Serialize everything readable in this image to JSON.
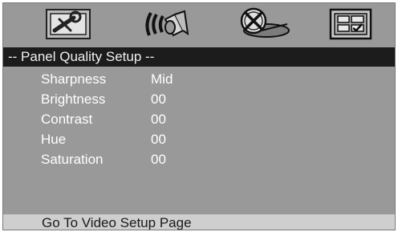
{
  "tabs": [
    {
      "icon": "wrench-settings-icon"
    },
    {
      "icon": "speaker-audio-icon"
    },
    {
      "icon": "disc-icon"
    },
    {
      "icon": "video-display-icon"
    }
  ],
  "title": "-- Panel Quality Setup --",
  "settings": [
    {
      "label": "Sharpness",
      "value": "Mid"
    },
    {
      "label": "Brightness",
      "value": "00"
    },
    {
      "label": "Contrast",
      "value": "00"
    },
    {
      "label": "Hue",
      "value": "00"
    },
    {
      "label": "Saturation",
      "value": "00"
    }
  ],
  "footer": "Go To Video Setup Page",
  "colors": {
    "panel_bg": "#999999",
    "title_bar_bg": "#1c1c1c",
    "footer_bg": "#cfcfcf",
    "text": "#ffffff"
  }
}
